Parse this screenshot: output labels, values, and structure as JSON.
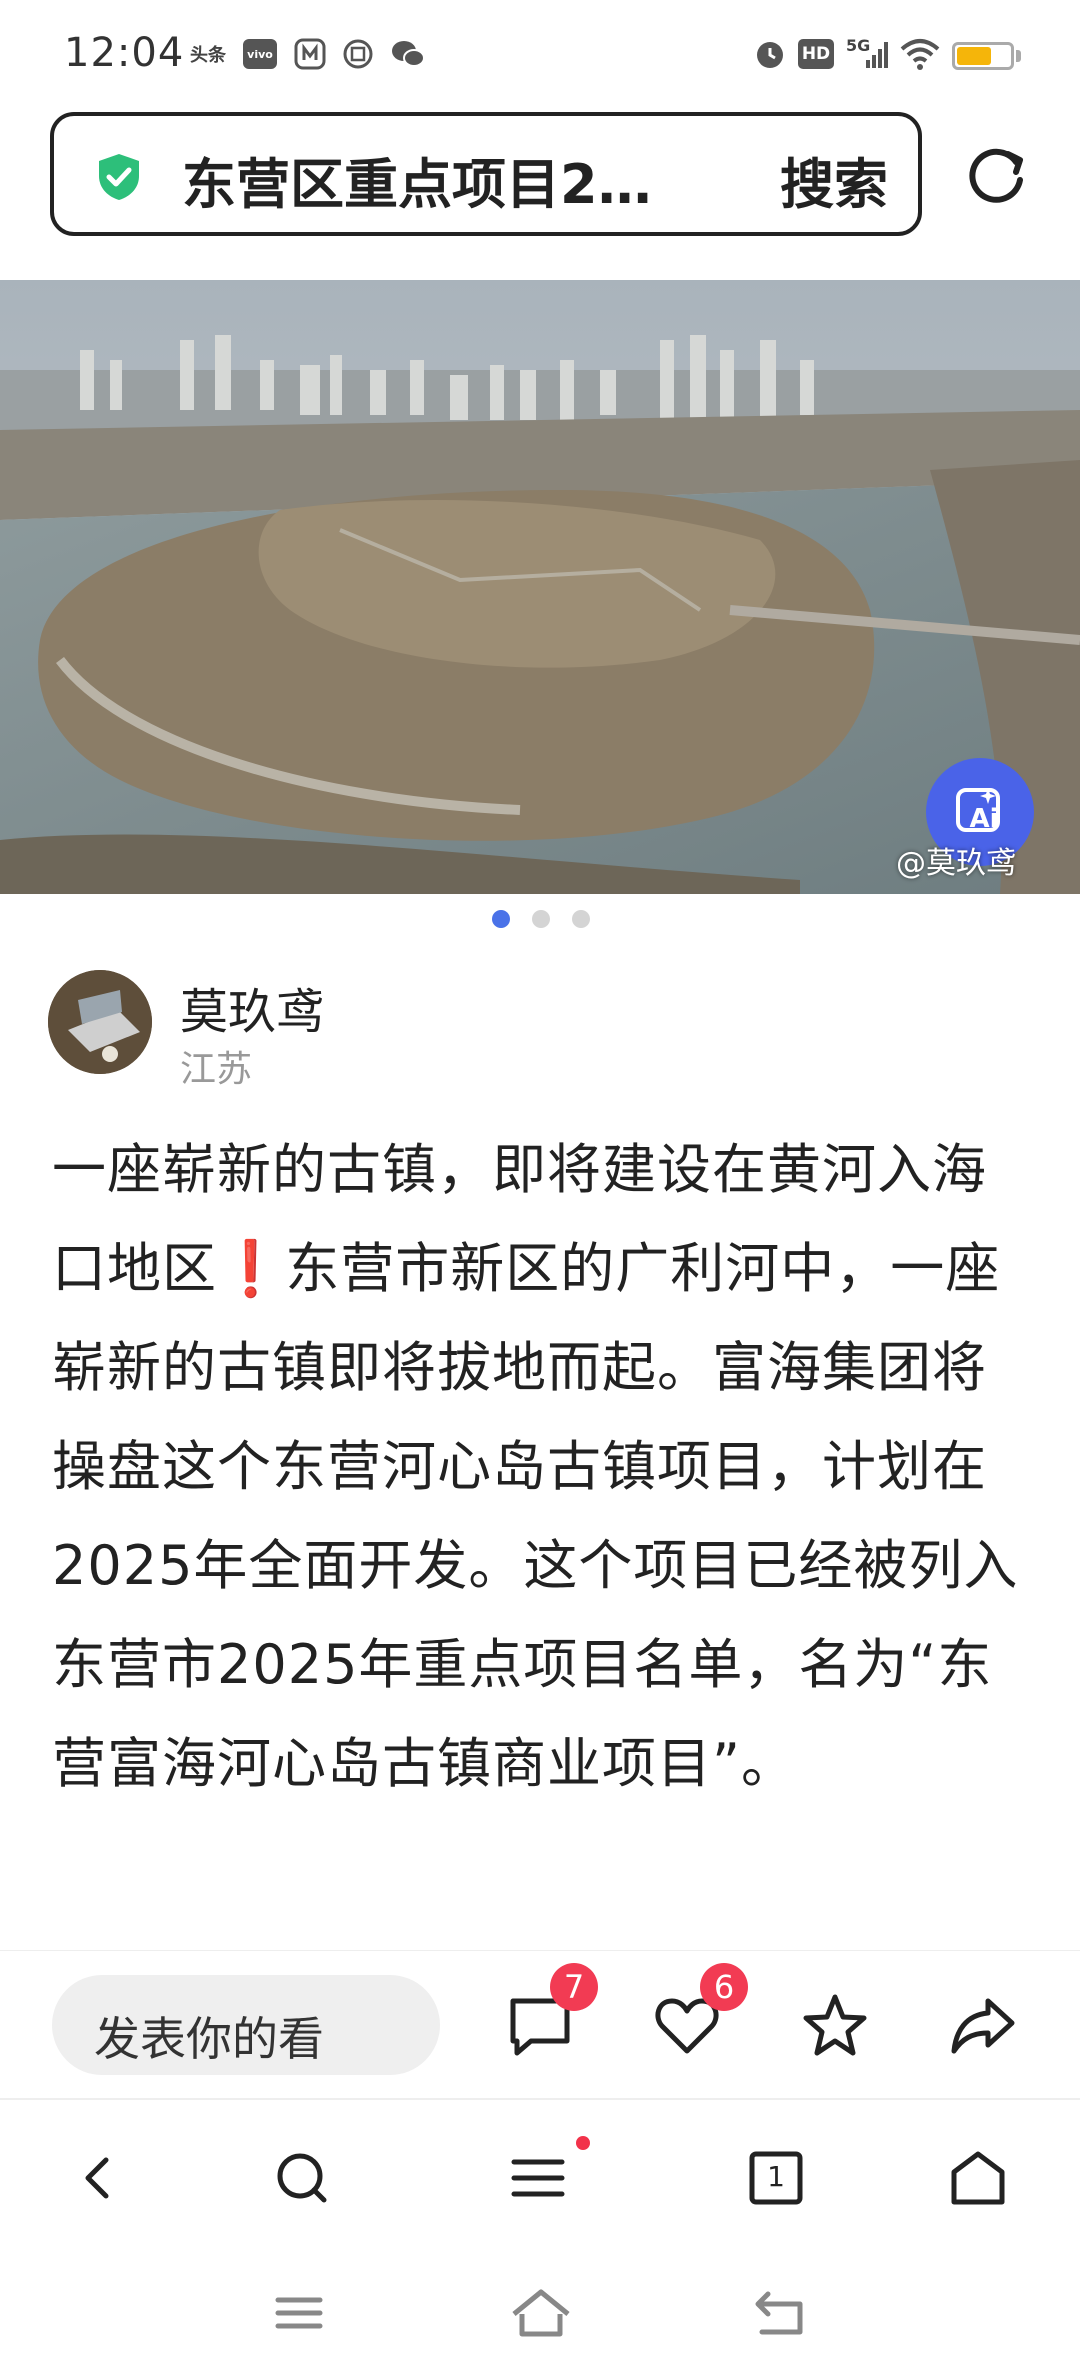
{
  "status_bar": {
    "time": "12:04",
    "left_icons": [
      "toutiao-app-icon",
      "vivo-app-icon",
      "app-icon",
      "ticket-app-icon",
      "wechat-icon"
    ],
    "toutiao_label": "头条",
    "vivo_label": "vivo",
    "right_icons": [
      "alarm-icon",
      "hd-icon",
      "5g-signal-icon",
      "wifi-icon",
      "battery-icon"
    ],
    "hd_label": "HD",
    "network_label": "5G",
    "battery_level": 0.65,
    "battery_color": "#f5b50a"
  },
  "search": {
    "query": "东营区重点项目2…",
    "button_label": "搜索",
    "shield_color": "#2dbf7a"
  },
  "hero_image": {
    "watermark": "@莫玖鸢",
    "ai_button_label": "Ai",
    "carousel_count": 3,
    "active_index": 0,
    "accent": "#4a63e8"
  },
  "author": {
    "name": "莫玖鸢",
    "location": "江苏"
  },
  "article": {
    "text_part1": "一座崭新的古镇，即将建设在黄河入海口地区",
    "emoji": "❗",
    "text_part2": "东营市新区的广利河中，一座崭新的古镇即将拔地而起。富海集团将操盘这个东营河心岛古镇项目，计划在2025年全面开发。这个项目已经被列入东营市2025年重点项目名单，名为“东营富海河心岛古镇商业项目”。"
  },
  "actions": {
    "comment_placeholder": "发表你的看",
    "comment_count": "7",
    "like_count": "6",
    "badge_color": "#f23b53"
  },
  "toolbar": {
    "tab_count": "1"
  }
}
